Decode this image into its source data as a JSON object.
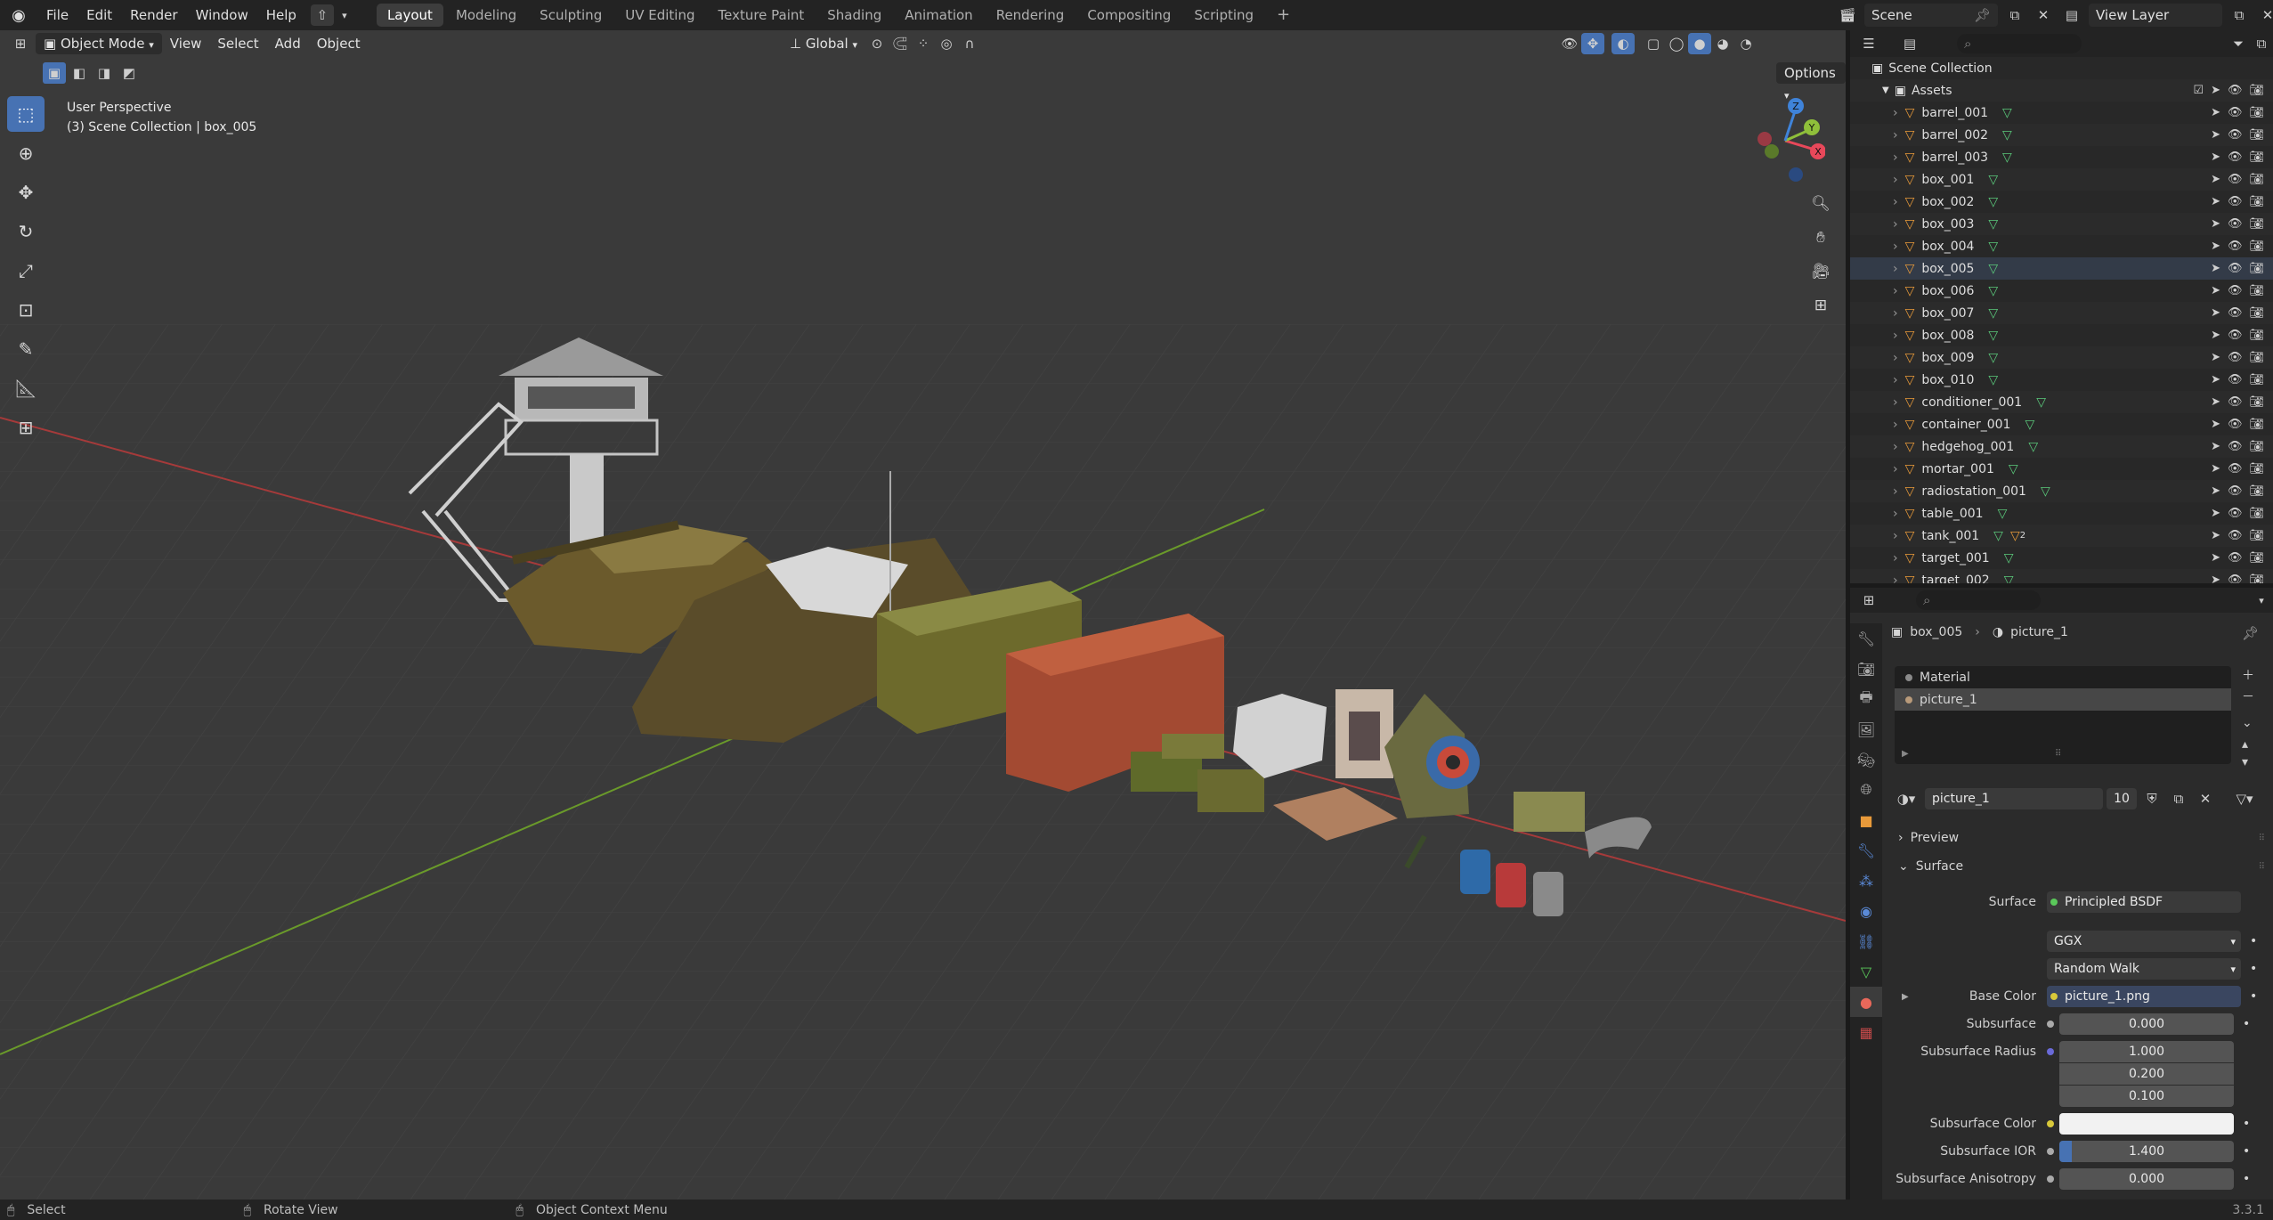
{
  "topbar": {
    "menus": [
      "File",
      "Edit",
      "Render",
      "Window",
      "Help"
    ],
    "workspaces": [
      "Layout",
      "Modeling",
      "Sculpting",
      "UV Editing",
      "Texture Paint",
      "Shading",
      "Animation",
      "Rendering",
      "Compositing",
      "Scripting"
    ],
    "active_workspace": "Layout",
    "add_workspace": "+",
    "scene": "Scene",
    "view_layer": "View Layer"
  },
  "viewport": {
    "mode": "Object Mode",
    "menus": [
      "View",
      "Select",
      "Add",
      "Object"
    ],
    "orientation": "Global",
    "options_label": "Options",
    "info_line1": "User Perspective",
    "info_line2": "(3) Scene Collection | box_005",
    "gizmo_axes": [
      "X",
      "Y",
      "Z"
    ]
  },
  "outliner": {
    "root": "Scene Collection",
    "collection": "Assets",
    "items": [
      {
        "name": "barrel_001",
        "selected": false
      },
      {
        "name": "barrel_002",
        "selected": false
      },
      {
        "name": "barrel_003",
        "selected": false
      },
      {
        "name": "box_001",
        "selected": false
      },
      {
        "name": "box_002",
        "selected": false
      },
      {
        "name": "box_003",
        "selected": false
      },
      {
        "name": "box_004",
        "selected": false
      },
      {
        "name": "box_005",
        "selected": true
      },
      {
        "name": "box_006",
        "selected": false
      },
      {
        "name": "box_007",
        "selected": false
      },
      {
        "name": "box_008",
        "selected": false
      },
      {
        "name": "box_009",
        "selected": false
      },
      {
        "name": "box_010",
        "selected": false
      },
      {
        "name": "conditioner_001",
        "selected": false
      },
      {
        "name": "container_001",
        "selected": false
      },
      {
        "name": "hedgehog_001",
        "selected": false
      },
      {
        "name": "mortar_001",
        "selected": false
      },
      {
        "name": "radiostation_001",
        "selected": false
      },
      {
        "name": "table_001",
        "selected": false
      },
      {
        "name": "tank_001",
        "selected": false
      },
      {
        "name": "target_001",
        "selected": false
      },
      {
        "name": "target_002",
        "selected": false
      }
    ],
    "tank_badge": "2"
  },
  "properties": {
    "breadcrumb_object": "box_005",
    "breadcrumb_material": "picture_1",
    "slots": [
      "Material",
      "picture_1"
    ],
    "material_name": "picture_1",
    "users": "10",
    "panels": {
      "preview": "Preview",
      "surface": "Surface"
    },
    "surface_label": "Surface",
    "surface_value": "Principled BSDF",
    "distribution": "GGX",
    "subsurface_method": "Random Walk",
    "base_color_label": "Base Color",
    "base_color_value": "picture_1.png",
    "subsurface_label": "Subsurface",
    "subsurface_value": "0.000",
    "subsurface_radius_label": "Subsurface Radius",
    "subsurface_radius": [
      "1.000",
      "0.200",
      "0.100"
    ],
    "subsurface_color_label": "Subsurface Color",
    "subsurface_ior_label": "Subsurface IOR",
    "subsurface_ior_value": "1.400",
    "subsurface_ior_fill": 0.07,
    "subsurface_aniso_label": "Subsurface Anisotropy",
    "subsurface_aniso_value": "0.000"
  },
  "statusbar": {
    "select": "Select",
    "rotate": "Rotate View",
    "context": "Object Context Menu",
    "version": "3.3.1"
  },
  "colors": {
    "accent": "#4772b3",
    "active_tab_icon": "#e8685a",
    "axis_x": "#e8485a",
    "axis_y": "#8fbf3a",
    "axis_z": "#3f83d9"
  }
}
